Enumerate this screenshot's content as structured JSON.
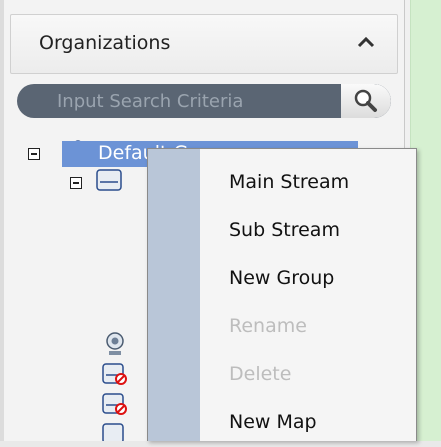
{
  "panel": {
    "title": "Organizations"
  },
  "search": {
    "placeholder": "Input Search Criteria"
  },
  "tree": {
    "root_label": "Default Group"
  },
  "context_menu": {
    "items": [
      {
        "label": "Main Stream",
        "enabled": true
      },
      {
        "label": "Sub Stream",
        "enabled": true
      },
      {
        "label": "New Group",
        "enabled": true
      },
      {
        "label": "Rename",
        "enabled": false
      },
      {
        "label": "Delete",
        "enabled": false
      },
      {
        "label": "New Map",
        "enabled": true
      }
    ]
  },
  "colors": {
    "selection": "#6c93d6",
    "search_bg": "#5a6573",
    "menu_gutter": "#b9c6d8",
    "disabled_text": "#bdbdbd"
  }
}
